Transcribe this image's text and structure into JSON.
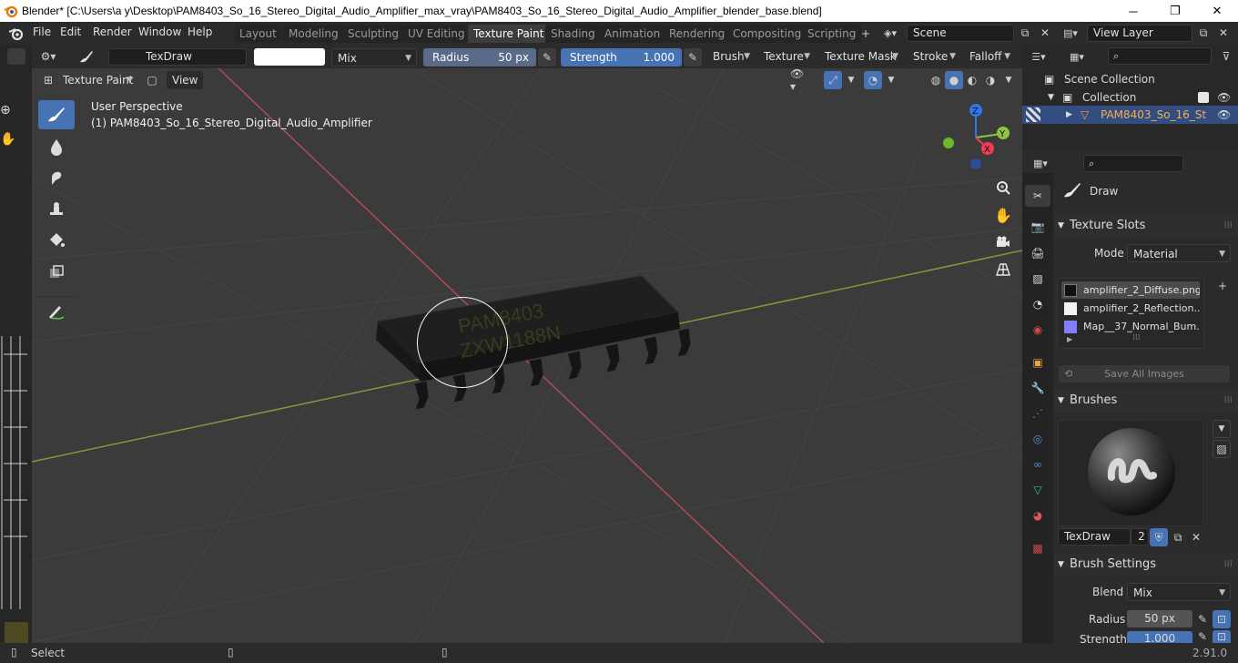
{
  "window": {
    "title": "Blender* [C:\\Users\\a y\\Desktop\\PAM8403_So_16_Stereo_Digital_Audio_Amplifier_max_vray\\PAM8403_So_16_Stereo_Digital_Audio_Amplifier_blender_base.blend]"
  },
  "menu": [
    "File",
    "Edit",
    "Render",
    "Window",
    "Help"
  ],
  "workspaces": [
    "Layout",
    "Modeling",
    "Sculpting",
    "UV Editing",
    "Texture Paint",
    "Shading",
    "Animation",
    "Rendering",
    "Compositing",
    "Scripting"
  ],
  "active_workspace": "Texture Paint",
  "scene": "Scene",
  "view_layer": "View Layer",
  "tool_header": {
    "brush_name": "TexDraw",
    "blend": "Mix",
    "radius_label": "Radius",
    "radius_value": "50 px",
    "strength_label": "Strength",
    "strength_value": "1.000",
    "menus": [
      "Brush",
      "Texture",
      "Texture Mask",
      "Stroke",
      "Falloff"
    ]
  },
  "viewport_header": {
    "mode": "Texture Paint",
    "view": "View"
  },
  "viewport": {
    "perspective": "User Perspective",
    "object_label": "(1) PAM8403_So_16_Stereo_Digital_Audio_Amplifier",
    "chip_text_1": "PAM8403",
    "chip_text_2": "ZXW1188N",
    "gizmo": {
      "z": "Z",
      "y": "Y",
      "x": "X"
    }
  },
  "outliner": {
    "scene_collection": "Scene Collection",
    "collection": "Collection",
    "object": "PAM8403_So_16_St"
  },
  "properties": {
    "tool_name": "Draw",
    "texture_slots": {
      "header": "Texture Slots",
      "mode_label": "Mode",
      "mode_value": "Material",
      "slots": [
        {
          "name": "amplifier_2_Diffuse.png",
          "color": "#111111"
        },
        {
          "name": "amplifier_2_Reflection...",
          "color": "#f2f2f2"
        },
        {
          "name": "Map__37_Normal_Bum...",
          "color": "#7f7fff"
        }
      ],
      "save_all": "Save All Images"
    },
    "brushes": {
      "header": "Brushes",
      "brush_name": "TexDraw",
      "users": "2"
    },
    "brush_settings": {
      "header": "Brush Settings",
      "blend_label": "Blend",
      "blend_value": "Mix",
      "radius_label": "Radius",
      "radius_value": "50 px",
      "strength_label": "Strength",
      "strength_value": "1.000"
    }
  },
  "statusbar": {
    "select": "Select",
    "version": "2.91.0"
  },
  "colors": {
    "accent": "#4772b3",
    "grid_x_axis": "#b34a58",
    "grid_y_axis": "#7b9c3c",
    "gizmo_z": "#2f77e8",
    "gizmo_y": "#8cc63e",
    "gizmo_x": "#ee3d52"
  }
}
